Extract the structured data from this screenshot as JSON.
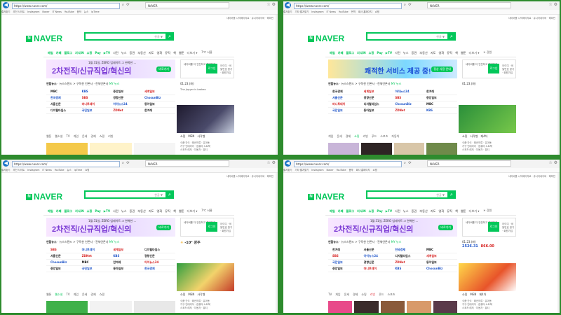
{
  "browser": {
    "address": "https://www.naver.com/",
    "tab_title": "NAVER",
    "bookmarks": [
      "즐겨찾기",
      "추천 사이트",
      "기타 즐겨찾기",
      "Instagram",
      "Naver",
      "IT News",
      "YouTube",
      "음악",
      "뉴스",
      "번역",
      "ipTime",
      "회사 홈페이지",
      "쇼핑"
    ]
  },
  "header": {
    "logo": "NAVER",
    "logo_mark": "N",
    "top_links": "네이버를 시작페이지로 · 쥬니어네이버 · 해피빈",
    "search_kbd": "한글 ▼"
  },
  "nav": {
    "items": [
      "메일",
      "카페",
      "블로그",
      "지식iN",
      "쇼핑",
      "Pay",
      "▶TV",
      "사전",
      "뉴스",
      "증권",
      "부동산",
      "지도",
      "영화",
      "뮤직",
      "책",
      "웹툰",
      "더보기 ▾"
    ]
  },
  "weather_mini": [
    "7℃ 서울",
    "-10° 광주",
    "☀ 강원"
  ],
  "banner": {
    "top_text": "1월 31일, ZERO 업데이트 그 완벽한 ...",
    "main_text": "2차전직/신규직업/혁신의",
    "badge": "바로가기",
    "alt_main": "쾌적한 서비스 제공 중!",
    "alt_small": "정상 사용 안내"
  },
  "login": {
    "title": "네이버를 더 안전하고 편리하게",
    "button": "로그인",
    "links": "아이디 · 비밀번호 찾기 · 회원가입"
  },
  "news": {
    "label": "연합뉴스",
    "tabs": "뉴스스탠드 > 구독한 언론사 · 전체언론사",
    "headline": "MY 뉴스",
    "press_rows": [
      [
        "MBC",
        "KBS",
        "중앙일보",
        "세계일보"
      ],
      [
        "한국경제",
        "SBS",
        "경향신문",
        "ChosunBiz"
      ],
      [
        "서울신문",
        "머니투데이",
        "아이뉴스24",
        "동아일보"
      ],
      [
        "디지털타임스",
        "국민일보",
        "ZDNet",
        "한겨레"
      ]
    ],
    "subtabs": [
      "웹툰",
      "웹소설",
      "TV",
      "게임",
      "운세",
      "경제",
      "쇼핑",
      "리빙",
      "푸드",
      "스포츠",
      "자동차"
    ]
  },
  "stock": {
    "date": "01.23.(화)",
    "kospi": "2526.31",
    "kosdaq": "866.00",
    "caption": "The Jupyer is broken"
  },
  "shop": {
    "tabs": [
      "쇼핑",
      "MEN",
      "사각형",
      "",
      "제4차"
    ],
    "list": [
      "식품·간식 · 패션의류 · 유아동",
      "가구·인테리어 · 컴퓨터·노트북",
      "스포츠·레저 · 자동차 · 뷰티"
    ]
  }
}
